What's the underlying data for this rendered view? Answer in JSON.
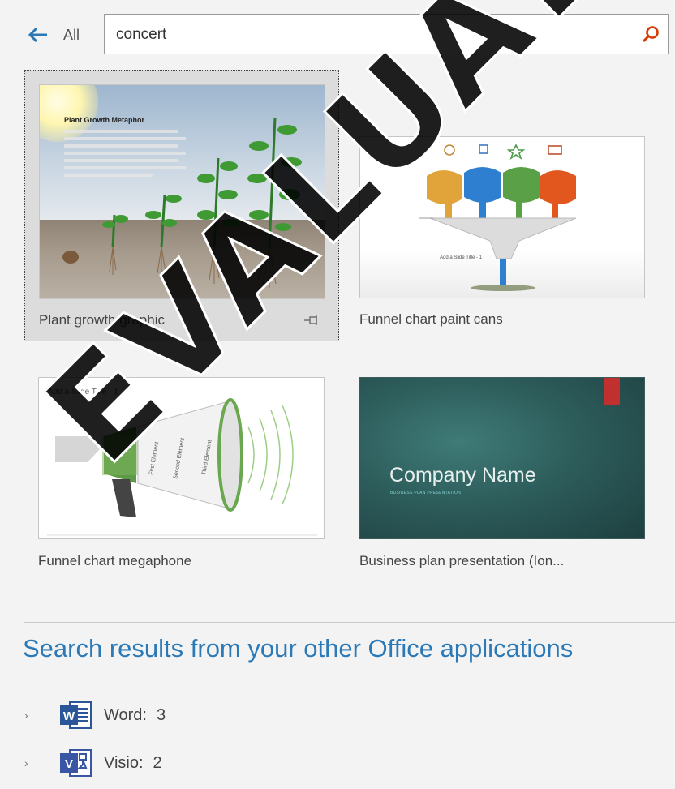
{
  "search": {
    "back_label": "All",
    "query": "concert"
  },
  "tiles": [
    {
      "label": "Plant growth graphic",
      "thumb_title": "Plant Growth Metaphor"
    },
    {
      "label": "Funnel chart paint cans"
    },
    {
      "label": "Funnel chart megaphone",
      "thumb_title": "Add a Slide Title - 1"
    },
    {
      "label": "Business plan presentation (Ion...",
      "thumb_title": "Company Name",
      "thumb_subtitle": "BUSINESS PLAN PRESENTATION"
    }
  ],
  "results": {
    "heading": "Search results from your other Office applications",
    "apps": [
      {
        "name": "Word:",
        "count": "3",
        "icon": "word-icon",
        "color": "#2b579a"
      },
      {
        "name": "Visio:",
        "count": "2",
        "icon": "visio-icon",
        "color": "#3955a3"
      }
    ]
  },
  "watermark": "EVALUATION",
  "colors": {
    "accent": "#2b79b6",
    "search_icon": "#d83b01",
    "selected_tile": "#dcdcdc"
  }
}
